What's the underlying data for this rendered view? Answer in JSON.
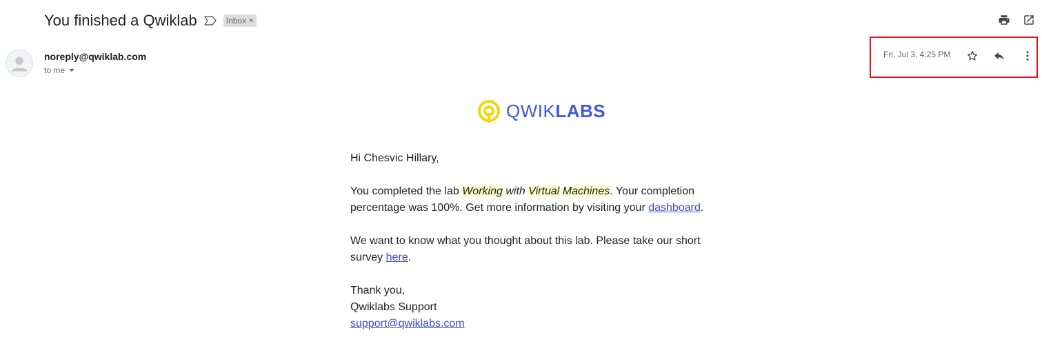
{
  "email": {
    "subject": "You finished a Qwiklab",
    "label": "Inbox",
    "label_remove": "×",
    "sender": "noreply@qwiklab.com",
    "recipient": "to me",
    "date": "Fri, Jul 3, 4:25 PM"
  },
  "actions": {
    "top": [
      "print-icon",
      "open-in-new-window-icon"
    ],
    "meta": [
      "star-icon",
      "reply-icon",
      "more-options-icon"
    ]
  },
  "logo": {
    "light": "QWIK",
    "bold": "LABS",
    "accent_color": "#f1d50f",
    "brand_color": "#3e5ad7"
  },
  "body": {
    "greeting": "Hi Chesvic Hillary,",
    "p1_start": "You completed the lab ",
    "lab_word1": "Working",
    "lab_word2": " with ",
    "lab_word3": "Virtual",
    "lab_space": " ",
    "lab_word4": "Machines",
    "p1_mid": ". Your completion percentage was 100%. Get more information by visiting your ",
    "dashboard_link": "dashboard",
    "p1_end": ".",
    "p2_start": "We want to know what you thought about this lab. Please take our short survey ",
    "here_link": "here",
    "p2_end": ".",
    "sign_thanks": "Thank you,",
    "sign_name": "Qwiklabs Support",
    "sign_email": "support@qwiklabs.com"
  }
}
